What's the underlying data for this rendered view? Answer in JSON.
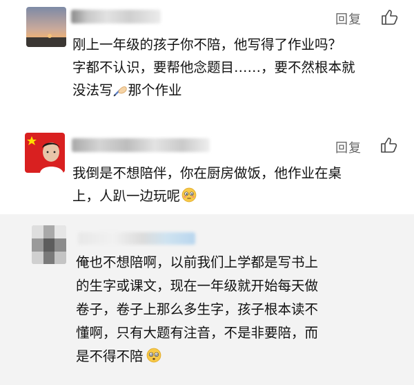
{
  "comments": [
    {
      "reply_label": "回复",
      "text_line1": "刚上一年级的孩子你不陪，他写得了作业吗？",
      "text_line2": "字都不认识，要帮他念题目……，要不然根本就",
      "text_line3a": "没法写",
      "text_line3b": "那个作业",
      "emoji": "writing-hand"
    },
    {
      "reply_label": "回复",
      "text_line1": "我倒是不想陪伴，你在厨房做饭，他作业在桌",
      "text_line2": "上，人趴一边玩呢",
      "emoji": "flushed-face"
    },
    {
      "text_line1": "俺也不想陪啊，以前我们上学都是写书上",
      "text_line2": "的生字或课文，现在一年级就开始每天做",
      "text_line3": "卷子，卷子上那么多生字，孩子根本读不",
      "text_line4": "懂啊，只有大题有注音，不是非要陪，而",
      "text_line5": "是不得不陪",
      "emoji": "dizzy-face"
    }
  ]
}
